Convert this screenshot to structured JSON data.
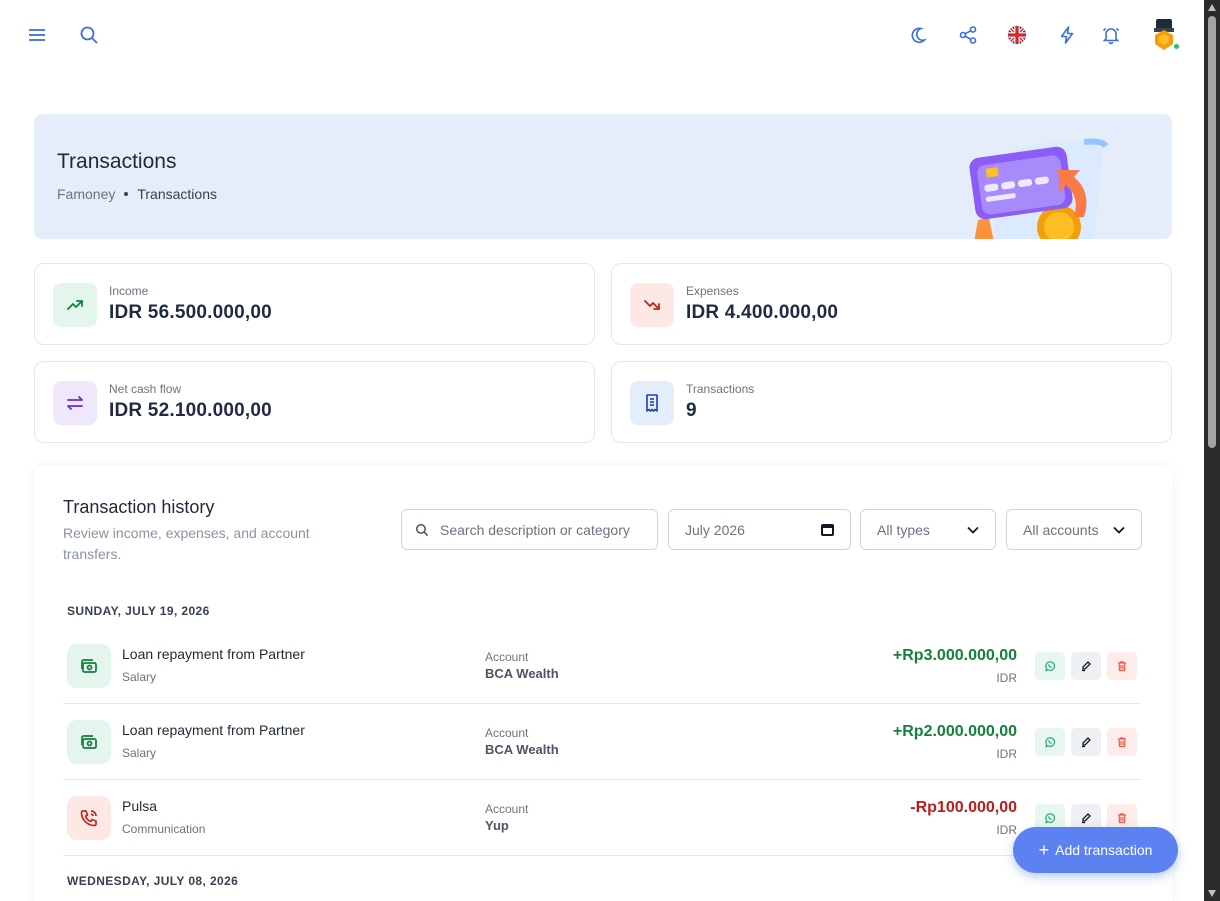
{
  "page": {
    "title": "Transactions",
    "breadcrumb": {
      "root": "Famoney",
      "current": "Transactions"
    }
  },
  "topbar": {
    "icons": [
      "menu-icon",
      "search-icon",
      "moon-icon",
      "share-icon",
      "uk-flag-icon",
      "bolt-icon",
      "bell-icon",
      "avatar"
    ]
  },
  "stats": {
    "income": {
      "label": "Income",
      "value": "IDR 56.500.000,00"
    },
    "expenses": {
      "label": "Expenses",
      "value": "IDR 4.400.000,00"
    },
    "net": {
      "label": "Net cash flow",
      "value": "IDR 52.100.000,00"
    },
    "count": {
      "label": "Transactions",
      "value": "9"
    }
  },
  "history": {
    "title": "Transaction history",
    "subtitle": "Review income, expenses, and account transfers.",
    "search_placeholder": "Search description or category",
    "month": "July 2026",
    "type_filter": "All types",
    "account_filter": "All accounts",
    "groups": [
      {
        "date": "SUNDAY, JULY 19, 2026",
        "items": [
          {
            "name": "Loan repayment from Partner",
            "category": "Salary",
            "account_label": "Account",
            "account": "BCA Wealth",
            "amount": "+Rp3.000.000,00",
            "currency": "IDR",
            "kind": "income"
          },
          {
            "name": "Loan repayment from Partner",
            "category": "Salary",
            "account_label": "Account",
            "account": "BCA Wealth",
            "amount": "+Rp2.000.000,00",
            "currency": "IDR",
            "kind": "income"
          },
          {
            "name": "Pulsa",
            "category": "Communication",
            "account_label": "Account",
            "account": "Yup",
            "amount": "-Rp100.000,00",
            "currency": "IDR",
            "kind": "expense"
          }
        ]
      },
      {
        "date": "WEDNESDAY, JULY 08, 2026",
        "items": []
      }
    ]
  },
  "fab": {
    "label": "Add transaction"
  },
  "colors": {
    "primary": "#3b6fd8",
    "income": "#15803d",
    "expense": "#b91c1c",
    "banner": "#e5edfb"
  }
}
